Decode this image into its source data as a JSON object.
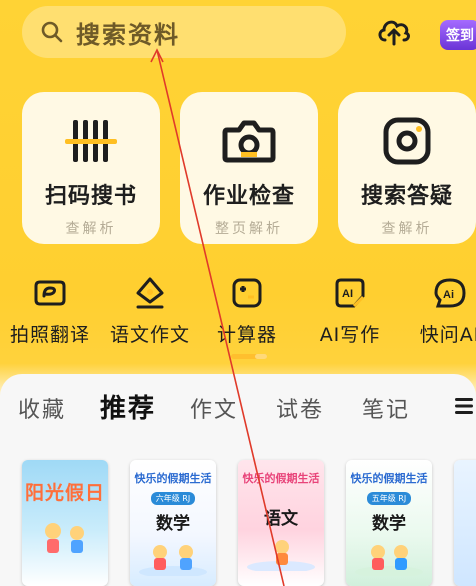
{
  "search": {
    "placeholder": "搜索资料"
  },
  "header": {
    "signin_label": "签到"
  },
  "cards": [
    {
      "title": "扫码搜书",
      "sub": "查解析",
      "icon": "barcode-scan-icon"
    },
    {
      "title": "作业检查",
      "sub": "整页解析",
      "icon": "camera-icon"
    },
    {
      "title": "搜索答疑",
      "sub": "查解析",
      "icon": "camera-search-icon"
    }
  ],
  "tools": [
    {
      "label": "拍照翻译",
      "icon": "translate-icon"
    },
    {
      "label": "语文作文",
      "icon": "essay-icon"
    },
    {
      "label": "计算器",
      "icon": "calculator-icon"
    },
    {
      "label": "AI写作",
      "icon": "ai-writing-icon"
    },
    {
      "label": "快问AI",
      "icon": "ai-ask-icon"
    }
  ],
  "tabs": [
    {
      "label": "收藏"
    },
    {
      "label": "推荐",
      "active": true
    },
    {
      "label": "作文"
    },
    {
      "label": "试卷"
    },
    {
      "label": "笔记"
    }
  ],
  "books": [
    {
      "title": "阳光假日",
      "header": "",
      "grade": "",
      "subject": ""
    },
    {
      "title": "",
      "header": "快乐的假期生活",
      "grade": "六年级 RJ",
      "subject": "数学"
    },
    {
      "title": "",
      "header": "快乐的假期生活",
      "grade": "",
      "subject": "语文"
    },
    {
      "title": "",
      "header": "快乐的假期生活",
      "grade": "五年级 RJ",
      "subject": "数学"
    }
  ],
  "colors": {
    "accent": "#ffcf30",
    "signin": "#7d45e8",
    "annotation_line": "#e03a2a"
  }
}
